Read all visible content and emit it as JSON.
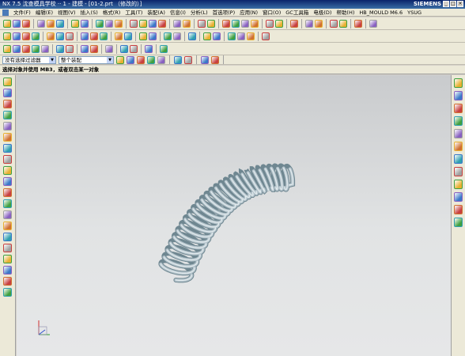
{
  "window": {
    "title": "NX 7.5 沈查模具学校 ·· 1 - 建模 - [01-2.prt （修改的）]",
    "brand": "SIEMENS",
    "controls": [
      "_",
      "□",
      "×"
    ]
  },
  "menu": {
    "items": [
      "文件(F)",
      "编辑(E)",
      "视图(V)",
      "插入(S)",
      "格式(R)",
      "工具(T)",
      "装配(A)",
      "信息(I)",
      "分析(L)",
      "首选项(P)",
      "应用(N)",
      "窗口(O)",
      "GC工具箱",
      "电极(D)",
      "帮助(H)",
      "HB_MOULD M6.6",
      "YSUG"
    ]
  },
  "selection": {
    "filter_value": "没有选择过滤器",
    "scope_value": "整个装配"
  },
  "cue": {
    "text": "选择对象并使用 MB3，或者双击某一对象"
  },
  "icons": {
    "toolbar1": [
      "new-icon",
      "open-icon",
      "save-icon",
      "sep",
      "cut-icon",
      "copy-icon",
      "paste-icon",
      "sep",
      "undo-icon",
      "redo-icon",
      "sep",
      "sketch-icon",
      "extrude-icon",
      "revolve-icon",
      "sep",
      "hole-icon",
      "boss-icon",
      "pocket-icon",
      "pad-icon",
      "sep",
      "blend-icon",
      "chamfer-icon",
      "sep",
      "shell-icon",
      "draft-icon",
      "sep",
      "view-fit-icon",
      "zoom-icon",
      "rotate-icon",
      "pan-icon",
      "sep",
      "shaded-icon",
      "wireframe-icon",
      "sep",
      "layer-icon",
      "sep",
      "trim-icon",
      "extend-icon",
      "sep",
      "mirror-icon",
      "pattern-icon",
      "sep",
      "measure-icon",
      "sep",
      "analysis-icon"
    ],
    "toolbar2": [
      "box-icon",
      "cylinder-icon",
      "cone-icon",
      "sphere-icon",
      "sep",
      "unite-icon",
      "subtract-icon",
      "intersect-icon",
      "sep",
      "datum-plane-icon",
      "datum-axis-icon",
      "datum-csys-icon",
      "sep",
      "offset-face-icon",
      "move-face-icon",
      "sep",
      "thicken-icon",
      "sew-icon",
      "sep",
      "surface-icon",
      "mesh-icon",
      "sep",
      "curve-icon",
      "sep",
      "mold-icon",
      "electrode-icon",
      "sep",
      "view-top-icon",
      "view-front-icon",
      "view-right-icon",
      "sep",
      "snap-icon"
    ],
    "toolbar3": [
      "spline-icon",
      "arc-icon",
      "polygon-icon",
      "rectangle-icon",
      "text-icon",
      "sep",
      "offset-curve-icon",
      "project-curve-icon",
      "sep",
      "helix-icon",
      "law-curve-icon",
      "sep",
      "point-icon",
      "sep",
      "line-icon",
      "circle-icon",
      "sep",
      "trim-curve-icon",
      "sep",
      "sketch-finish-icon"
    ],
    "left": [
      "part-nav-icon",
      "layer-icon",
      "roles-icon",
      "spline-icon",
      "line-icon",
      "arc-icon",
      "circle-icon",
      "fillet-icon",
      "rectangle-icon",
      "polygon-icon",
      "point-icon",
      "move-icon",
      "trim-icon",
      "extend-icon",
      "offset-icon",
      "mirror-icon",
      "pattern-icon",
      "constraint-icon",
      "dimension-icon",
      "finish-icon"
    ],
    "right": [
      "assembly-nav-icon",
      "part-nav-icon",
      "history-icon",
      "reuse-icon",
      "web-icon",
      "clock-icon",
      "palette-icon",
      "system-icon",
      "analysis-icon",
      "roles-icon",
      "list-icon",
      "doc-icon"
    ]
  },
  "colors": {
    "spring": "#b4c3cb",
    "spring_dark": "#6f8791",
    "spring_light": "#e3ecef",
    "viewport_top": "#c9cbcd",
    "viewport_bottom": "#e6e7e8"
  }
}
